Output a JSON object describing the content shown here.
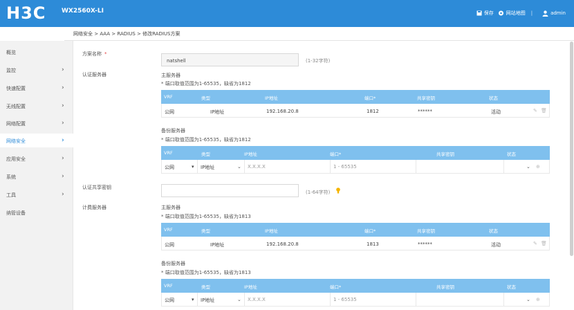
{
  "header": {
    "logo": "H3C",
    "model": "WX2560X-LI",
    "save_label": "保存",
    "sitemap_label": "网站地图",
    "separator": "|",
    "user_label": "admin",
    "bg_color": "#2d8bd8"
  },
  "breadcrumb": "网络安全 > AAA > RADIUS > 修改RADIUS方案",
  "sidebar": {
    "items": [
      {
        "label": "概览",
        "chevron": ""
      },
      {
        "label": "监控",
        "chevron": "›"
      },
      {
        "label": "快速配置",
        "chevron": "›"
      },
      {
        "label": "无线配置",
        "chevron": "›"
      },
      {
        "label": "网络配置",
        "chevron": "›"
      },
      {
        "label": "网络安全",
        "chevron": "›"
      },
      {
        "label": "应用安全",
        "chevron": "›"
      },
      {
        "label": "系统",
        "chevron": "›"
      },
      {
        "label": "工具",
        "chevron": "›"
      },
      {
        "label": "纳管设备",
        "chevron": ""
      }
    ],
    "active_index": 5
  },
  "form": {
    "scheme_name_label": "方案名称",
    "required_mark": "*",
    "scheme_name_value": "natshell",
    "scheme_name_hint": "(1-32字符)",
    "auth_server_label": "认证服务器",
    "auth_shared_key_label": "认证共享密钥",
    "auth_shared_key_hint": "(1-64字符)",
    "acct_server_label": "计费服务器"
  },
  "auth": {
    "primary_title": "主服务器",
    "primary_note": "* 端口取值范围为1-65535，缺省为1812",
    "backup_title": "备份服务器",
    "backup_note": "* 端口取值范围为1-65535，缺省为1812"
  },
  "acct": {
    "primary_title": "主服务器",
    "primary_note": "* 端口取值范围为1-65535，缺省为1813",
    "backup_title": "备份服务器",
    "backup_note": "* 端口取值范围为1-65535，缺省为1813"
  },
  "columns": [
    "VRF",
    "类型",
    "IP地址",
    "端口*",
    "共享密钥",
    "状态"
  ],
  "auth_primary_row": {
    "vrf": "公网",
    "type": "IP地址",
    "ip": "192.168.20.8",
    "port": "1812",
    "key": "******",
    "status": "活动"
  },
  "acct_primary_row": {
    "vrf": "公网",
    "type": "IP地址",
    "ip": "192.168.20.8",
    "port": "1813",
    "key": "******",
    "status": "活动"
  },
  "backup_row": {
    "vrf": "公网",
    "type": "IP地址",
    "ip_placeholder": "X.X.X.X",
    "port_placeholder": "1 - 65535",
    "key": "",
    "status": ""
  }
}
